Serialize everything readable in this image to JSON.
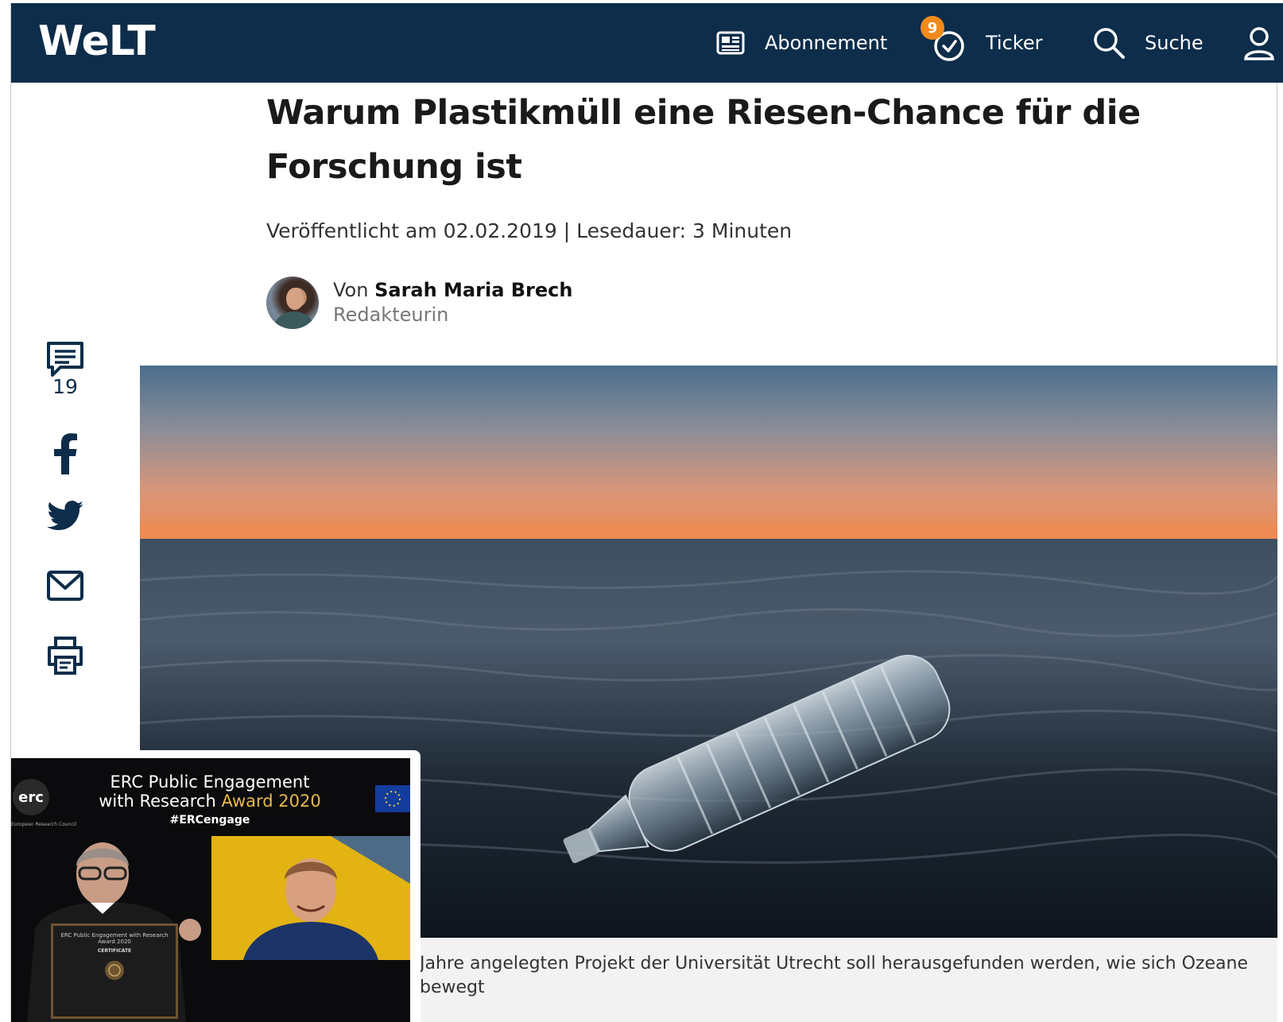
{
  "header": {
    "logo": "WeLT",
    "nav": {
      "abonnement": "Abonnement",
      "ticker": "Ticker",
      "ticker_badge": "9",
      "search": "Suche"
    },
    "colors": {
      "bar": "#0d2d4a",
      "badge": "#f08a1c"
    }
  },
  "article": {
    "headline": "Warum Plastikmüll eine Riesen-Chance für die Forschung ist",
    "published": "Veröffentlicht am 02.02.2019 | Lesedauer: 3 Minuten",
    "author_prefix": "Von",
    "author_name": "Sarah Maria Brech",
    "author_role": "Redakteurin",
    "caption": "Jahre angelegten Projekt der Universität Utrecht soll herausgefunden werden, wie sich Ozeane bewegt"
  },
  "share": {
    "comment_count": "19",
    "icons": [
      "comment-icon",
      "facebook-icon",
      "twitter-icon",
      "mail-icon",
      "print-icon"
    ]
  },
  "overlay": {
    "erc_logo": "erc",
    "erc_small": "European Research Council",
    "title_line1": "ERC Public Engagement",
    "title_line2_prefix": "with Research ",
    "title_line2_gold": "Award 2020",
    "hashtag": "#ERCengage",
    "certificate_title": "ERC Public Engagement with Research Award 2020",
    "certificate_label": "CERTIFICATE"
  }
}
